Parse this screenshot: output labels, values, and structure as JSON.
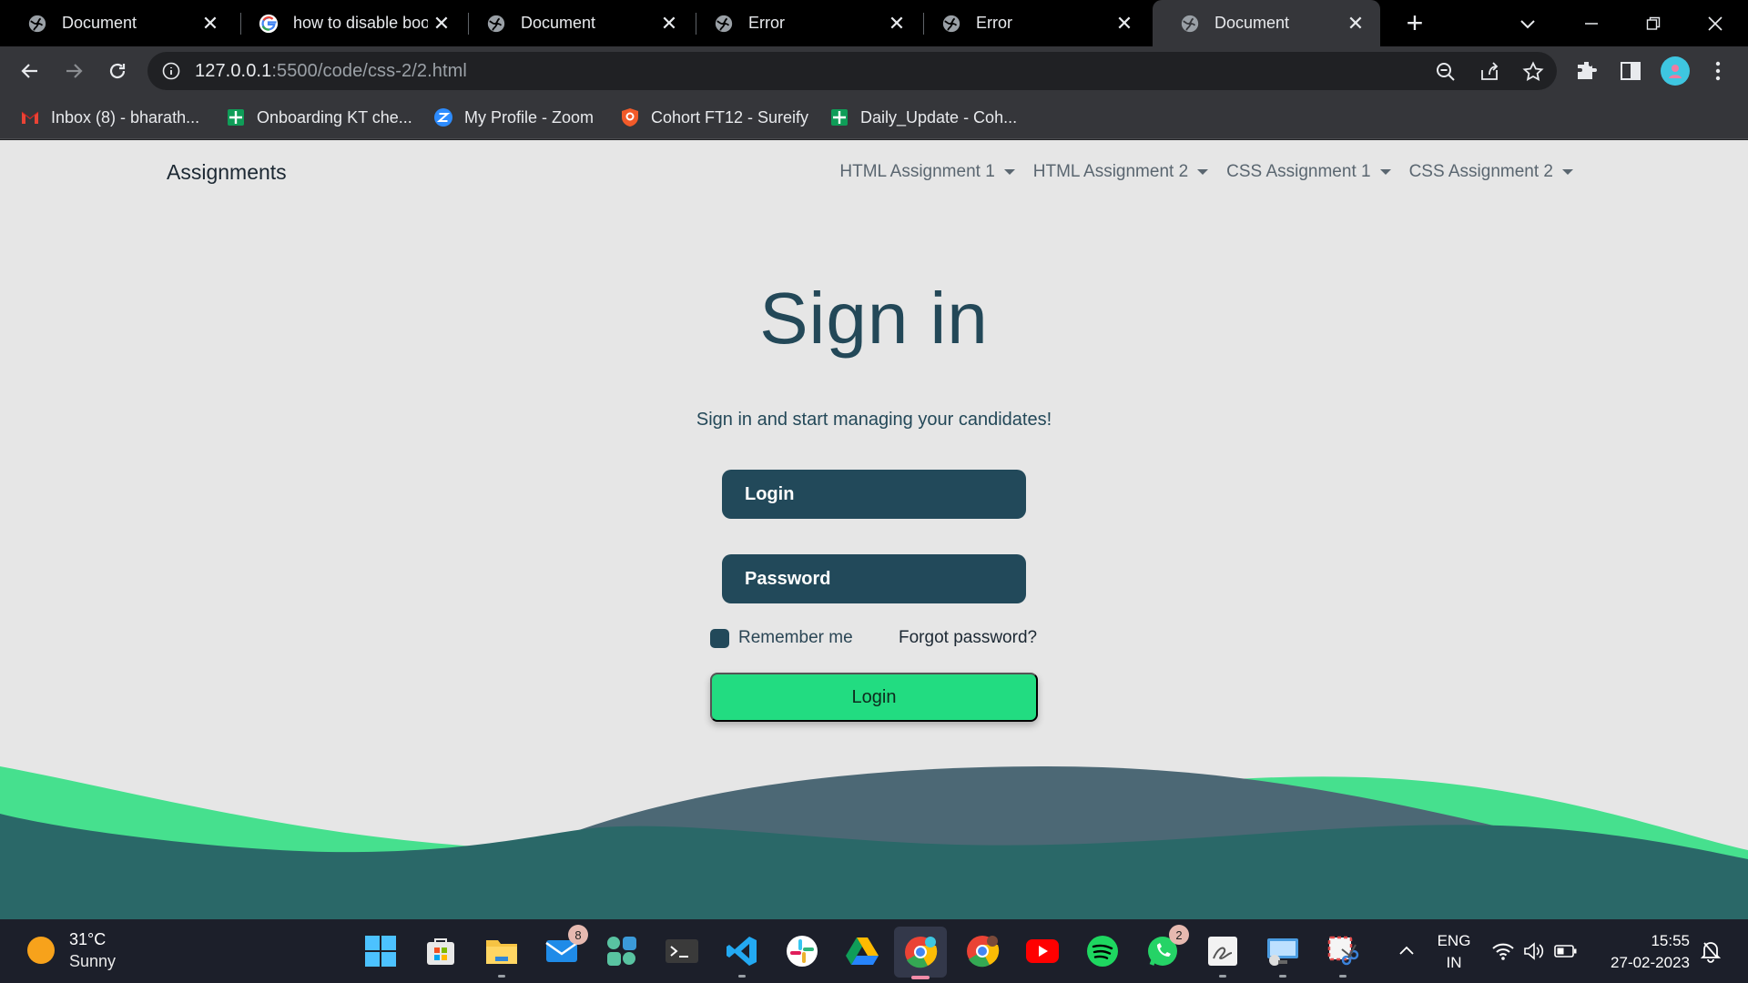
{
  "browser": {
    "tabs": [
      {
        "title": "Document",
        "active": false
      },
      {
        "title": "how to disable boo",
        "active": false
      },
      {
        "title": "Document",
        "active": false
      },
      {
        "title": "Error",
        "active": false
      },
      {
        "title": "Error",
        "active": false
      },
      {
        "title": "Document",
        "active": true
      }
    ],
    "url_host": "127.0.0.1",
    "url_rest": ":5500/code/css-2/2.html",
    "bookmarks": [
      {
        "label": "Inbox (8) - bharath...",
        "icon": "gmail-icon"
      },
      {
        "label": "Onboarding KT che...",
        "icon": "sheets-icon"
      },
      {
        "label": "My Profile - Zoom",
        "icon": "zoom-icon"
      },
      {
        "label": "Cohort FT12 - Sureify",
        "icon": "shield-icon"
      },
      {
        "label": "Daily_Update - Coh...",
        "icon": "sheets-icon"
      }
    ]
  },
  "page": {
    "brand": "Assignments",
    "nav": [
      {
        "label": "HTML Assignment 1"
      },
      {
        "label": "HTML Assignment 2"
      },
      {
        "label": "CSS Assignment 1"
      },
      {
        "label": "CSS Assignment 2"
      }
    ],
    "heading": "Sign in",
    "subtitle": "Sign in and start managing your candidates!",
    "login_placeholder": "Login",
    "password_placeholder": "Password",
    "remember_label": "Remember me",
    "forgot_label": "Forgot password?",
    "login_button": "Login",
    "colors": {
      "primary": "#22495a",
      "accent": "#22dc81",
      "background": "#e6e6e6"
    }
  },
  "taskbar": {
    "temperature": "31°C",
    "condition": "Sunny",
    "mail_badge": "8",
    "whatsapp_badge": "2",
    "lang_line1": "ENG",
    "lang_line2": "IN",
    "time": "15:55",
    "date": "27-02-2023"
  }
}
